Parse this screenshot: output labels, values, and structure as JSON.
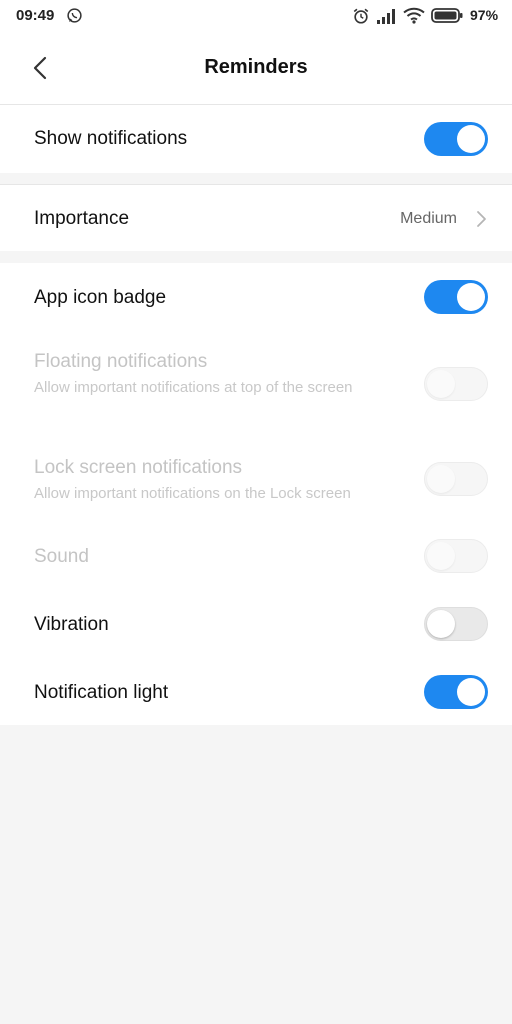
{
  "status_bar": {
    "time": "09:49",
    "battery_percent": "97%",
    "icons": [
      "whatsapp-icon",
      "alarm-icon",
      "signal-icon",
      "wifi-icon",
      "battery-icon"
    ]
  },
  "header": {
    "title": "Reminders",
    "back_icon": "chevron-left-icon"
  },
  "settings": {
    "show_notifications": {
      "label": "Show notifications",
      "enabled": true
    },
    "importance": {
      "label": "Importance",
      "value": "Medium"
    },
    "app_icon_badge": {
      "label": "App icon badge",
      "enabled": true
    },
    "floating_notifications": {
      "label": "Floating notifications",
      "description": "Allow important notifications at top of the screen",
      "enabled": false,
      "disabled": true
    },
    "lock_screen_notifications": {
      "label": "Lock screen notifications",
      "description": "Allow important notifications on the Lock screen",
      "enabled": false,
      "disabled": true
    },
    "sound": {
      "label": "Sound",
      "enabled": false,
      "disabled": true
    },
    "vibration": {
      "label": "Vibration",
      "enabled": false
    },
    "notification_light": {
      "label": "Notification light",
      "enabled": true
    }
  },
  "colors": {
    "accent": "#1e88f0",
    "background": "#f5f5f5",
    "disabled_text": "#c4c4c4"
  }
}
